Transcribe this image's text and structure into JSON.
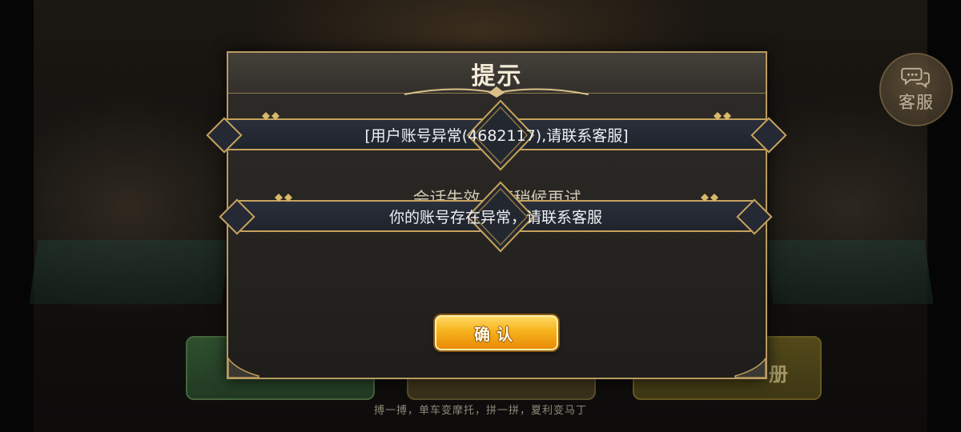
{
  "lobby": {
    "service_label": "客服",
    "mode_right_label": "册",
    "marquee": "搏一搏，单车变摩托，拼一拼，夏利变马丁"
  },
  "dialog": {
    "title": "提示",
    "banner_error": "[用户账号异常(4682117),请联系客服]",
    "session_message": "会话失效，请稍候再试",
    "banner_account": "你的账号存在异常，请联系客服",
    "confirm_label": "确认"
  },
  "colors": {
    "accent_gold": "#c6a25c",
    "button_orange": "#f7b21c",
    "banner_bg": "#242934"
  }
}
